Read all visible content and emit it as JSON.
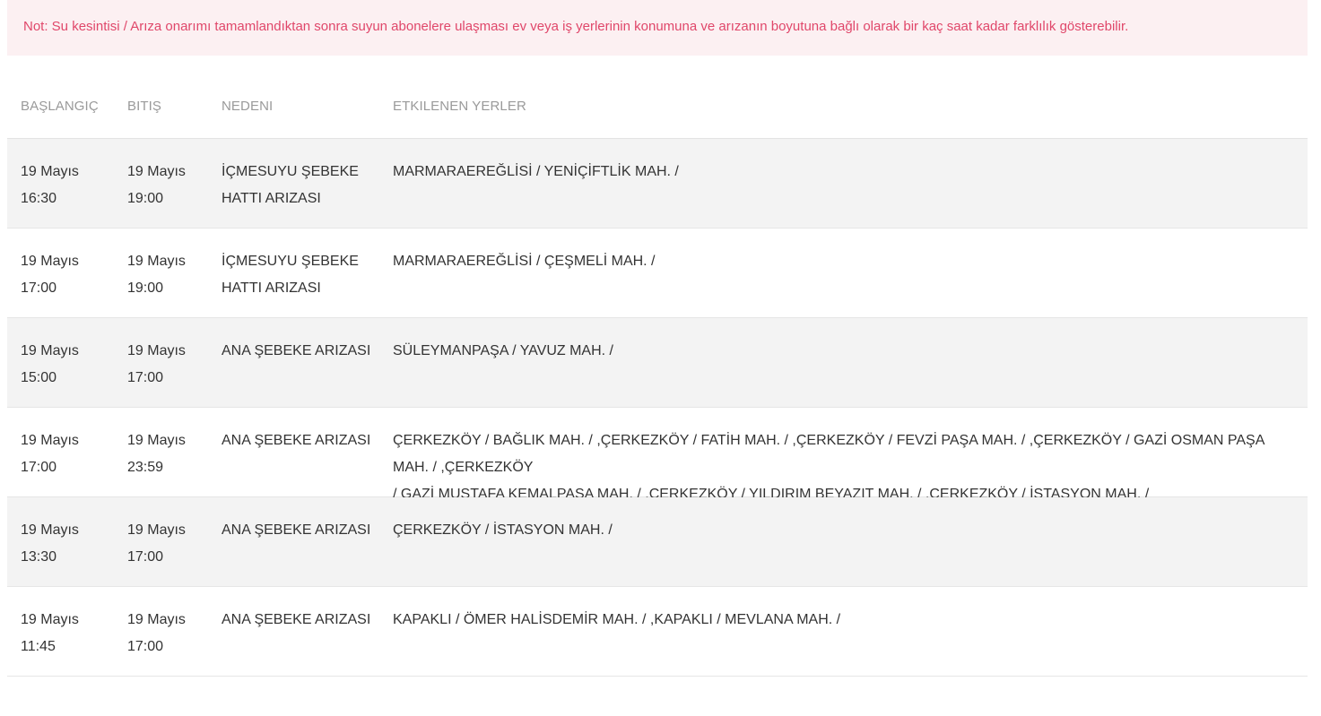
{
  "notice": "Not: Su kesintisi / Arıza onarımı tamamlandıktan sonra suyun abonelere ulaşması ev veya iş yerlerinin konumuna ve arızanın boyutuna bağlı olarak bir kaç saat kadar farklılık gösterebilir.",
  "colors": {
    "notice_bg": "#fcf0f2",
    "notice_text": "#e0476a",
    "alt_row_bg": "#f3f3f3",
    "header_text": "#9a9a9a"
  },
  "table": {
    "headers": [
      "BAŞLANGIÇ",
      "BITIŞ",
      "NEDENI",
      "ETKILENEN YERLER"
    ],
    "rows": [
      {
        "start": [
          "19 Mayıs",
          "16:30"
        ],
        "end": [
          "19 Mayıs",
          "19:00"
        ],
        "reason": [
          "İÇMESUYU ŞEBEKE",
          "HATTI ARIZASI"
        ],
        "places": [
          "MARMARAEREĞLİSİ / YENİÇİFTLİK MAH. /"
        ]
      },
      {
        "start": [
          "19 Mayıs",
          "17:00"
        ],
        "end": [
          "19 Mayıs",
          "19:00"
        ],
        "reason": [
          "İÇMESUYU ŞEBEKE",
          "HATTI ARIZASI"
        ],
        "places": [
          "MARMARAEREĞLİSİ / ÇEŞMELİ MAH. /"
        ]
      },
      {
        "start": [
          "19 Mayıs",
          "15:00"
        ],
        "end": [
          "19 Mayıs",
          "17:00"
        ],
        "reason": [
          "ANA ŞEBEKE ARIZASI"
        ],
        "places": [
          "SÜLEYMANPAŞA / YAVUZ MAH. /"
        ]
      },
      {
        "start": [
          "19 Mayıs",
          "17:00"
        ],
        "end": [
          "19 Mayıs",
          "23:59"
        ],
        "reason": [
          "ANA ŞEBEKE ARIZASI"
        ],
        "places": [
          "ÇERKEZKÖY / BAĞLIK MAH. / ,ÇERKEZKÖY / FATİH MAH. / ,ÇERKEZKÖY / FEVZİ PAŞA MAH. / ,ÇERKEZKÖY / GAZİ OSMAN PAŞA MAH. / ,ÇERKEZKÖY",
          "/ GAZİ MUSTAFA KEMALPAŞA MAH. / ,ÇERKEZKÖY / YILDIRIM BEYAZIT MAH. / ,ÇERKEZKÖY / İSTASYON MAH. /"
        ]
      },
      {
        "start": [
          "19 Mayıs",
          "13:30"
        ],
        "end": [
          "19 Mayıs",
          "17:00"
        ],
        "reason": [
          "ANA ŞEBEKE ARIZASI"
        ],
        "places": [
          "ÇERKEZKÖY / İSTASYON MAH. /"
        ]
      },
      {
        "start": [
          "19 Mayıs",
          "11:45"
        ],
        "end": [
          "19 Mayıs",
          "17:00"
        ],
        "reason": [
          "ANA ŞEBEKE ARIZASI"
        ],
        "places": [
          "KAPAKLI / ÖMER HALİSDEMİR MAH. / ,KAPAKLI / MEVLANA MAH. /"
        ]
      }
    ]
  }
}
